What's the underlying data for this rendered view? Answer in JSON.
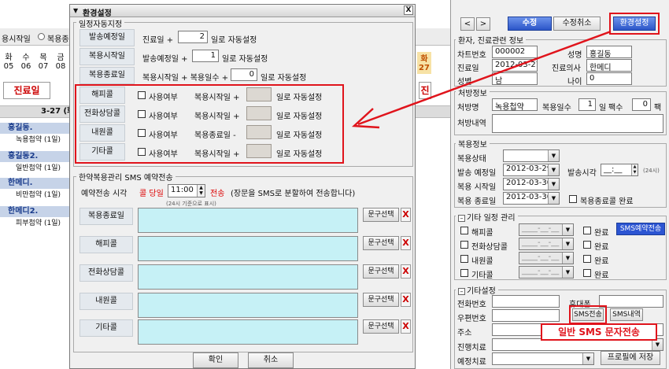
{
  "background": {
    "tab_label": "용시작일",
    "radio_label": "복용종",
    "days": [
      {
        "name": "화",
        "num": "05"
      },
      {
        "name": "수",
        "num": "06"
      },
      {
        "name": "목",
        "num": "07"
      },
      {
        "name": "금",
        "num": "08"
      }
    ],
    "right_day": {
      "name": "화",
      "num": "27"
    },
    "clinic_tab": "진료일",
    "week_label": "3-27 (화)",
    "items": [
      {
        "name": "홍길동.",
        "sub": "녹용첩약 (1일)"
      },
      {
        "name": "홍길동2.",
        "sub": "일반첩약 (1일)"
      },
      {
        "name": "한메디.",
        "sub": "비만첩약 (1일)"
      },
      {
        "name": "한메디2.",
        "sub": "피부첩약 (1일)"
      }
    ]
  },
  "dialog": {
    "title": "환경설정",
    "close": "X",
    "auto": {
      "group": "일정자동지정",
      "rows": [
        {
          "label": "발송예정일",
          "prefix": "진료일 +",
          "value": "2",
          "suffix": "일로 자동설정"
        },
        {
          "label": "복용시작일",
          "prefix": "발송예정일 +",
          "value": "1",
          "suffix": "일로 자동설정"
        },
        {
          "label": "복용종료일",
          "prefix": "복용시작일 + 복용일수 +",
          "value": "0",
          "suffix": "일로 자동설정"
        }
      ],
      "calls": [
        {
          "label": "해피콜",
          "use": "사용여부",
          "base": "복용시작일 +",
          "suffix": "일로 자동설정"
        },
        {
          "label": "전화상담콜",
          "use": "사용여부",
          "base": "복용시작일 +",
          "suffix": "일로 자동설정"
        },
        {
          "label": "내원콜",
          "use": "사용여부",
          "base": "복용종료일 -",
          "suffix": "일로 자동설정"
        },
        {
          "label": "기타콜",
          "use": "사용여부",
          "base": "복용시작일 +",
          "suffix": "일로 자동설정"
        }
      ]
    },
    "sms": {
      "group": "한약복용관리 SMS 예약전송",
      "time_label": "예약전송 시각",
      "call_day": "콜 당일",
      "time": "11:00",
      "send": "전송",
      "note": "(장문을 SMS로 분할하여 전송합니다)",
      "hint": "(24시 기준으로 표시)",
      "rows": [
        {
          "label": "복용종료일",
          "btn": "문구선택",
          "x": "X"
        },
        {
          "label": "해피콜",
          "btn": "문구선택",
          "x": "X"
        },
        {
          "label": "전화상담콜",
          "btn": "문구선택",
          "x": "X"
        },
        {
          "label": "내원콜",
          "btn": "문구선택",
          "x": "X"
        },
        {
          "label": "기타콜",
          "btn": "문구선택",
          "x": "X"
        }
      ]
    },
    "ok": "확인",
    "cancel": "취소"
  },
  "right": {
    "nav_prev": "<",
    "nav_next": ">",
    "edit": "수정",
    "edit_cancel": "수정취소",
    "settings": "환경설정",
    "patient": {
      "title": "환자, 진료관련 정보",
      "chart_no_label": "차트번호",
      "chart_no": "000002",
      "name_label": "성명",
      "name": "홍길동",
      "visit_label": "진료일",
      "visit": "2012-03-27",
      "doctor_label": "진료의사",
      "doctor": "한메디",
      "gender_label": "성별",
      "gender": "남",
      "age_label": "나이",
      "age": "0"
    },
    "rx": {
      "title": "처방정보",
      "name_label": "처방명",
      "name": "녹용첩약",
      "days_label": "복용일수",
      "days": "1",
      "days_unit": "일",
      "packs_label": "팩수",
      "packs": "0",
      "packs_unit": "팩",
      "detail_label": "처방내역"
    },
    "med": {
      "title": "복용정보",
      "status_label": "복용상태",
      "ship_label": "발송 예정일",
      "ship": "2012-03-29",
      "ship_time_label": "발송시각",
      "ship_time": "__:__",
      "ship_time_hint": "(24시)",
      "start_label": "복용 시작일",
      "start": "2012-03-30",
      "end_label": "복용 종료일",
      "end": "2012-03-30",
      "end_call": "복용종료콜 완료"
    },
    "other": {
      "title": "기타 일정 관리",
      "sms_reserve": "SMS예약전송",
      "rows": [
        {
          "label": "해피콜",
          "date": "____-__-__",
          "done": "완료"
        },
        {
          "label": "전화상담콜",
          "date": "____-__-__",
          "done": "완료"
        },
        {
          "label": "내원콜",
          "date": "____-__-__",
          "done": "완료"
        },
        {
          "label": "기타콜",
          "date": "____-__-__",
          "done": "완료"
        }
      ]
    },
    "etc": {
      "title": "기타설정",
      "phone_label": "전화번호",
      "mobile_label": "휴대폰",
      "zip_label": "우편번호",
      "sms_send": "SMS전송",
      "sms_history": "SMS내역",
      "address_label": "주소",
      "progress_label": "진행치료",
      "planned_label": "예정치료",
      "profile_save": "프로필에 저장"
    },
    "callout": "일반 SMS 문자전송"
  },
  "colors": {
    "highlight": "#e0141c",
    "arrow": "#e0141c",
    "accent": "#3a64d6",
    "teal": "#c6f1f6",
    "blueheader": "#c6d3e8"
  }
}
